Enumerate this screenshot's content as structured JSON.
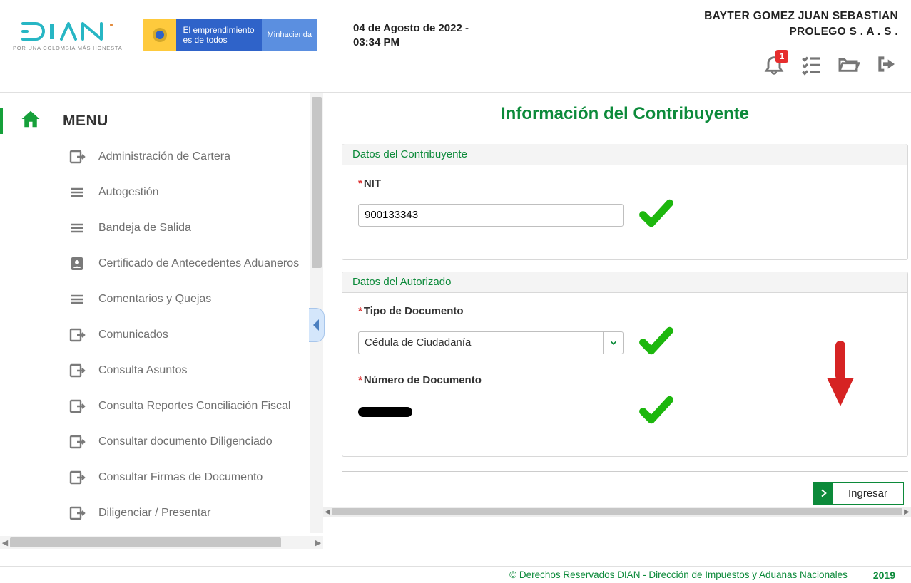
{
  "header": {
    "dian_slogan": "POR UNA COLOMBIA MÁS HONESTA",
    "gov_text1": "El emprendimiento",
    "gov_text2": "es de todos",
    "gov_minh": "Minhacienda",
    "date_line1": "04 de Agosto de 2022 -",
    "date_line2": "03:34 PM",
    "user_line1": "BAYTER GOMEZ JUAN SEBASTIAN",
    "user_line2": "PROLEGO S . A . S .",
    "notif_count": "1"
  },
  "sidebar": {
    "menu_title": "MENU",
    "items": [
      {
        "label": "Administración de Cartera",
        "icon": "exit"
      },
      {
        "label": "Autogestión",
        "icon": "lines"
      },
      {
        "label": "Bandeja de Salida",
        "icon": "lines"
      },
      {
        "label": "Certificado de Antecedentes Aduaneros",
        "icon": "badge"
      },
      {
        "label": "Comentarios y Quejas",
        "icon": "lines"
      },
      {
        "label": "Comunicados",
        "icon": "exit"
      },
      {
        "label": "Consulta Asuntos",
        "icon": "exit"
      },
      {
        "label": "Consulta Reportes Conciliación Fiscal",
        "icon": "exit"
      },
      {
        "label": "Consultar documento Diligenciado",
        "icon": "exit"
      },
      {
        "label": "Consultar Firmas de Documento",
        "icon": "exit"
      },
      {
        "label": "Diligenciar / Presentar",
        "icon": "exit"
      }
    ]
  },
  "main": {
    "title": "Información del Contribuyente",
    "fs1_legend": "Datos del Contribuyente",
    "nit_label": "NIT",
    "nit_value": "900133343",
    "fs2_legend": "Datos del Autorizado",
    "tipo_label": "Tipo de Documento",
    "tipo_value": "Cédula de Ciudadanía",
    "numdoc_label": "Número de Documento",
    "btn_label": "Ingresar"
  },
  "footer": {
    "copy": "© Derechos Reservados DIAN - Dirección de Impuestos y Aduanas Nacionales",
    "year": "2019"
  }
}
